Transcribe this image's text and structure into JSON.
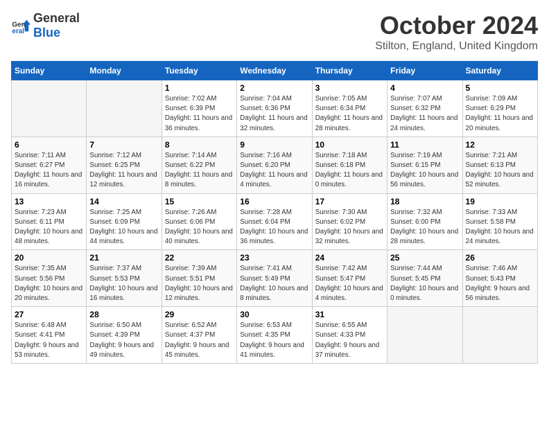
{
  "logo": {
    "general": "General",
    "blue": "Blue"
  },
  "title": "October 2024",
  "location": "Stilton, England, United Kingdom",
  "headers": [
    "Sunday",
    "Monday",
    "Tuesday",
    "Wednesday",
    "Thursday",
    "Friday",
    "Saturday"
  ],
  "weeks": [
    [
      {
        "day": "",
        "info": ""
      },
      {
        "day": "",
        "info": ""
      },
      {
        "day": "1",
        "info": "Sunrise: 7:02 AM\nSunset: 6:39 PM\nDaylight: 11 hours and 36 minutes."
      },
      {
        "day": "2",
        "info": "Sunrise: 7:04 AM\nSunset: 6:36 PM\nDaylight: 11 hours and 32 minutes."
      },
      {
        "day": "3",
        "info": "Sunrise: 7:05 AM\nSunset: 6:34 PM\nDaylight: 11 hours and 28 minutes."
      },
      {
        "day": "4",
        "info": "Sunrise: 7:07 AM\nSunset: 6:32 PM\nDaylight: 11 hours and 24 minutes."
      },
      {
        "day": "5",
        "info": "Sunrise: 7:09 AM\nSunset: 6:29 PM\nDaylight: 11 hours and 20 minutes."
      }
    ],
    [
      {
        "day": "6",
        "info": "Sunrise: 7:11 AM\nSunset: 6:27 PM\nDaylight: 11 hours and 16 minutes."
      },
      {
        "day": "7",
        "info": "Sunrise: 7:12 AM\nSunset: 6:25 PM\nDaylight: 11 hours and 12 minutes."
      },
      {
        "day": "8",
        "info": "Sunrise: 7:14 AM\nSunset: 6:22 PM\nDaylight: 11 hours and 8 minutes."
      },
      {
        "day": "9",
        "info": "Sunrise: 7:16 AM\nSunset: 6:20 PM\nDaylight: 11 hours and 4 minutes."
      },
      {
        "day": "10",
        "info": "Sunrise: 7:18 AM\nSunset: 6:18 PM\nDaylight: 11 hours and 0 minutes."
      },
      {
        "day": "11",
        "info": "Sunrise: 7:19 AM\nSunset: 6:15 PM\nDaylight: 10 hours and 56 minutes."
      },
      {
        "day": "12",
        "info": "Sunrise: 7:21 AM\nSunset: 6:13 PM\nDaylight: 10 hours and 52 minutes."
      }
    ],
    [
      {
        "day": "13",
        "info": "Sunrise: 7:23 AM\nSunset: 6:11 PM\nDaylight: 10 hours and 48 minutes."
      },
      {
        "day": "14",
        "info": "Sunrise: 7:25 AM\nSunset: 6:09 PM\nDaylight: 10 hours and 44 minutes."
      },
      {
        "day": "15",
        "info": "Sunrise: 7:26 AM\nSunset: 6:06 PM\nDaylight: 10 hours and 40 minutes."
      },
      {
        "day": "16",
        "info": "Sunrise: 7:28 AM\nSunset: 6:04 PM\nDaylight: 10 hours and 36 minutes."
      },
      {
        "day": "17",
        "info": "Sunrise: 7:30 AM\nSunset: 6:02 PM\nDaylight: 10 hours and 32 minutes."
      },
      {
        "day": "18",
        "info": "Sunrise: 7:32 AM\nSunset: 6:00 PM\nDaylight: 10 hours and 28 minutes."
      },
      {
        "day": "19",
        "info": "Sunrise: 7:33 AM\nSunset: 5:58 PM\nDaylight: 10 hours and 24 minutes."
      }
    ],
    [
      {
        "day": "20",
        "info": "Sunrise: 7:35 AM\nSunset: 5:56 PM\nDaylight: 10 hours and 20 minutes."
      },
      {
        "day": "21",
        "info": "Sunrise: 7:37 AM\nSunset: 5:53 PM\nDaylight: 10 hours and 16 minutes."
      },
      {
        "day": "22",
        "info": "Sunrise: 7:39 AM\nSunset: 5:51 PM\nDaylight: 10 hours and 12 minutes."
      },
      {
        "day": "23",
        "info": "Sunrise: 7:41 AM\nSunset: 5:49 PM\nDaylight: 10 hours and 8 minutes."
      },
      {
        "day": "24",
        "info": "Sunrise: 7:42 AM\nSunset: 5:47 PM\nDaylight: 10 hours and 4 minutes."
      },
      {
        "day": "25",
        "info": "Sunrise: 7:44 AM\nSunset: 5:45 PM\nDaylight: 10 hours and 0 minutes."
      },
      {
        "day": "26",
        "info": "Sunrise: 7:46 AM\nSunset: 5:43 PM\nDaylight: 9 hours and 56 minutes."
      }
    ],
    [
      {
        "day": "27",
        "info": "Sunrise: 6:48 AM\nSunset: 4:41 PM\nDaylight: 9 hours and 53 minutes."
      },
      {
        "day": "28",
        "info": "Sunrise: 6:50 AM\nSunset: 4:39 PM\nDaylight: 9 hours and 49 minutes."
      },
      {
        "day": "29",
        "info": "Sunrise: 6:52 AM\nSunset: 4:37 PM\nDaylight: 9 hours and 45 minutes."
      },
      {
        "day": "30",
        "info": "Sunrise: 6:53 AM\nSunset: 4:35 PM\nDaylight: 9 hours and 41 minutes."
      },
      {
        "day": "31",
        "info": "Sunrise: 6:55 AM\nSunset: 4:33 PM\nDaylight: 9 hours and 37 minutes."
      },
      {
        "day": "",
        "info": ""
      },
      {
        "day": "",
        "info": ""
      }
    ]
  ]
}
